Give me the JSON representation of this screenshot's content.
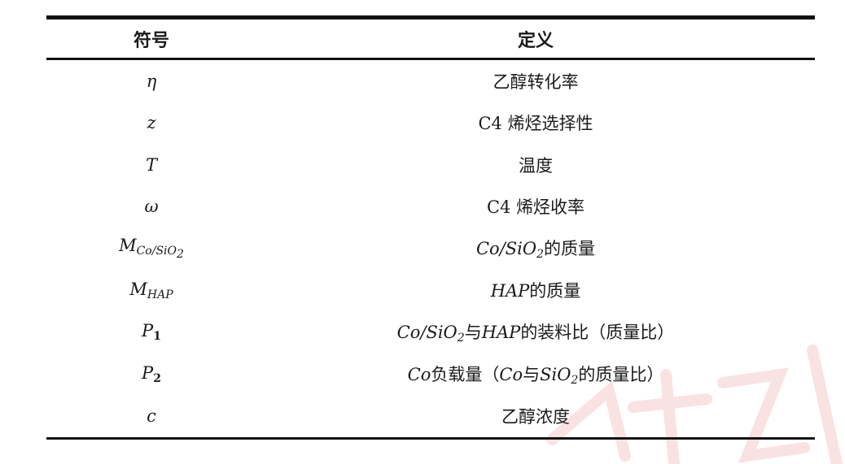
{
  "table": {
    "headers": [
      "符号",
      "定义"
    ],
    "rows": [
      {
        "symbol": "η",
        "definition": "乙醇转化率"
      },
      {
        "symbol": "z",
        "definition": "C4 烯烃选择性"
      },
      {
        "symbol": "T",
        "definition": "温度"
      },
      {
        "symbol": "ω",
        "definition": "C4 烯烃收率"
      },
      {
        "symbol_base": "M",
        "symbol_sub": "Co/SiO",
        "symbol_sub2": "2",
        "def_it": "Co/SiO",
        "def_sub": "2",
        "def_text": "的质量"
      },
      {
        "symbol_base": "M",
        "symbol_sub": "HAP",
        "def_it": "HAP",
        "def_text": "的质量"
      },
      {
        "symbol_base": "P",
        "symbol_sub": "1",
        "def_it1": "Co/SiO",
        "def_sub": "2",
        "def_text1": "与",
        "def_it2": "HAP",
        "def_text2": "的装料比（质量比）"
      },
      {
        "symbol_base": "P",
        "symbol_sub": "2",
        "def_it1": "Co",
        "def_text1": "负载量（",
        "def_it2": "Co",
        "def_text2": "与",
        "def_it3": "SiO",
        "def_sub": "2",
        "def_text3": "的质量比）"
      },
      {
        "symbol": "c",
        "definition": "乙醇浓度"
      }
    ]
  },
  "watermark": {
    "color": "#f6d4d4"
  }
}
